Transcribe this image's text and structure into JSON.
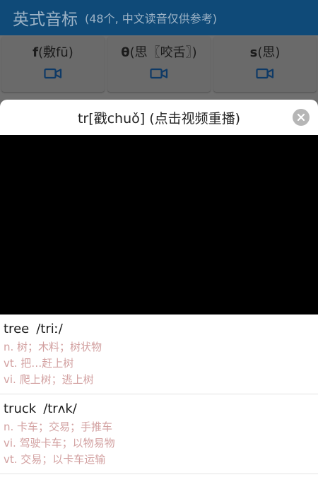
{
  "header": {
    "title": "英式音标",
    "subtitle": "(48个, 中文读音仅供参考)"
  },
  "keys": [
    {
      "symbol": "f",
      "hint": "(敷fū)"
    },
    {
      "symbol": "θ",
      "hint": "(思〖咬舌〗)"
    },
    {
      "symbol": "s",
      "hint": "(思)"
    }
  ],
  "modal": {
    "title": "tr[戳chuǒ] (点击视频重播)"
  },
  "words": [
    {
      "word": "tree",
      "phonetic": "/triː/",
      "defs": [
        "n. 树；木料；树状物",
        "vt. 把…赶上树",
        "vi. 爬上树；逃上树"
      ]
    },
    {
      "word": "truck",
      "phonetic": "/trʌk/",
      "defs": [
        "n. 卡车；交易；手推车",
        "vi. 驾驶卡车；以物易物",
        "vt. 交易；以卡车运输"
      ]
    }
  ],
  "colors": {
    "header_bg": "#0f4a78",
    "video_icon": "#1a5fa0",
    "definition_text": "#d2a0a0"
  }
}
